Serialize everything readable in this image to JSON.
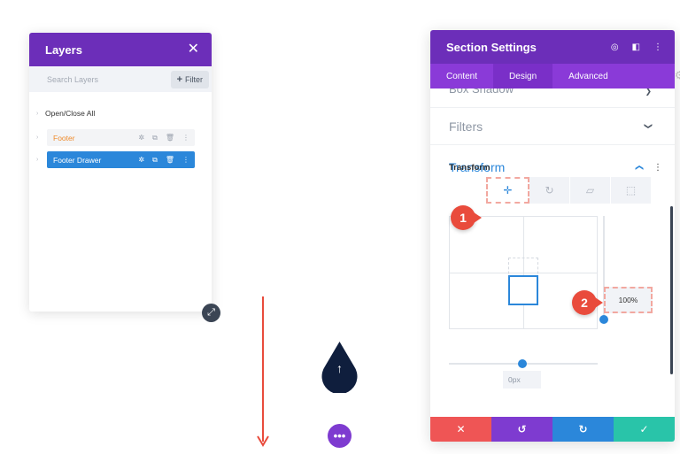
{
  "layers_panel": {
    "title": "Layers",
    "close_glyph": "✕",
    "search_placeholder": "Search Layers",
    "filter_label": "Filter",
    "filter_glyph": "+",
    "open_close_all": "Open/Close All",
    "items": [
      {
        "label": "Footer",
        "state": "default"
      },
      {
        "label": "Footer Drawer",
        "state": "selected"
      }
    ],
    "item_icons": [
      "gear-icon",
      "duplicate-icon",
      "trash-icon",
      "more-icon"
    ]
  },
  "canvas": {
    "drop_button_glyph": "↑",
    "dots_button_glyph": "•••",
    "resize_glyph": "⤢"
  },
  "settings_panel": {
    "title": "Section Settings",
    "header_icons": [
      "target-icon",
      "sidebar-icon",
      "more-icon"
    ],
    "tabs": [
      {
        "label": "Content",
        "active": false
      },
      {
        "label": "Design",
        "active": true
      },
      {
        "label": "Advanced",
        "active": false
      }
    ],
    "groups": {
      "box_shadow": "Box Shadow",
      "filters": "Filters",
      "transform": "Transform"
    },
    "transform_sublabel": "Transform",
    "transform_tabs": [
      "translate-icon",
      "rotate-icon",
      "skew-icon",
      "origin-icon"
    ],
    "translate_y_value": "100%",
    "translate_x_value": "0px",
    "footer_buttons": [
      {
        "name": "cancel",
        "glyph": "✕",
        "color": "#ef5555"
      },
      {
        "name": "undo",
        "glyph": "↺",
        "color": "#7e3bd0"
      },
      {
        "name": "redo",
        "glyph": "↻",
        "color": "#2b87da"
      },
      {
        "name": "save",
        "glyph": "✓",
        "color": "#29c4a9"
      }
    ]
  },
  "callouts": [
    {
      "number": "1"
    },
    {
      "number": "2"
    }
  ],
  "colors": {
    "purple_header": "#6c2eb9",
    "purple_tabs": "#8a3ad8",
    "blue_accent": "#2b87da",
    "navy_button": "#0f1e3d",
    "callout_red": "#e94b3c"
  }
}
